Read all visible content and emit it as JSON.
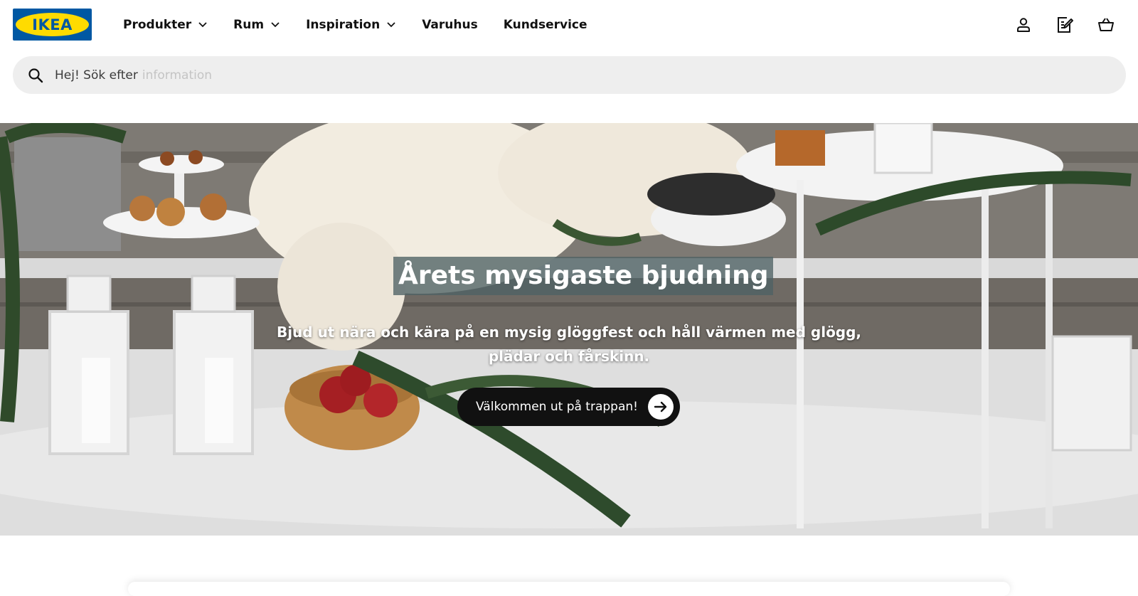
{
  "header": {
    "logo_text": "IKEA",
    "nav": [
      {
        "label": "Produkter",
        "dropdown": true
      },
      {
        "label": "Rum",
        "dropdown": true
      },
      {
        "label": "Inspiration",
        "dropdown": true
      },
      {
        "label": "Varuhus",
        "dropdown": false
      },
      {
        "label": "Kundservice",
        "dropdown": false
      }
    ],
    "icons": [
      "user-icon",
      "shopping-list-icon",
      "shopping-cart-icon"
    ]
  },
  "search": {
    "label": "Hej! Sök efter",
    "placeholder": "information",
    "icon": "search-icon"
  },
  "hero": {
    "title": "Årets mysigaste bjudning",
    "subtitle": "Bjud ut nära och kära på en mysig glöggfest och håll värmen med glögg, plädar och fårskinn.",
    "cta_label": "Välkommen ut på trappan!",
    "cta_icon": "arrow-right-icon"
  },
  "colors": {
    "brand_blue": "#0058a3",
    "brand_yellow": "#ffdb00",
    "search_bg": "#eeeeee",
    "cta_bg": "#111111"
  }
}
